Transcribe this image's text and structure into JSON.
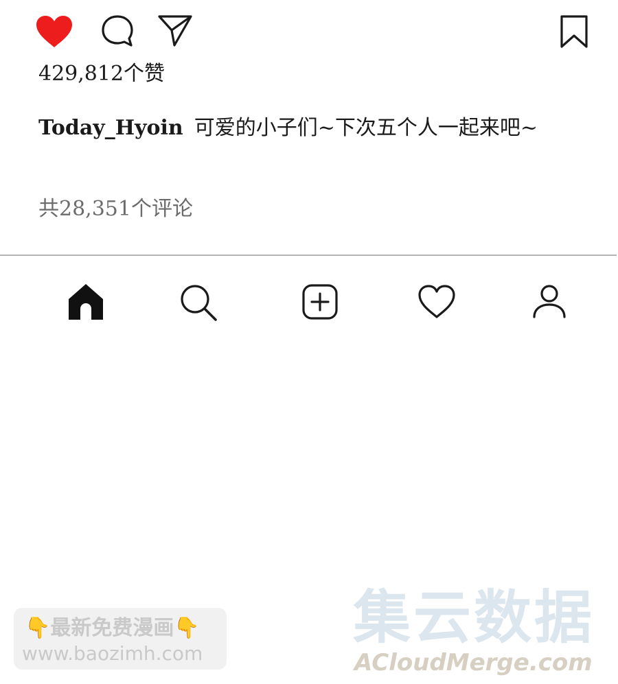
{
  "post": {
    "likes_text": "429,812个赞",
    "caption": {
      "username": "Today_Hyoin",
      "text": "可爱的小子们~下次五个人一起来吧~"
    },
    "comments_text": "共28,351个评论"
  },
  "actions": {
    "like_icon": "heart-filled-icon",
    "comment_icon": "comment-icon",
    "share_icon": "paper-plane-icon",
    "bookmark_icon": "bookmark-icon",
    "like_color": "#ee1d1d"
  },
  "bottom_nav": {
    "items": [
      {
        "icon": "home-icon",
        "active": true
      },
      {
        "icon": "search-icon",
        "active": false
      },
      {
        "icon": "add-post-icon",
        "active": false
      },
      {
        "icon": "heart-outline-icon",
        "active": false
      },
      {
        "icon": "profile-icon",
        "active": false
      }
    ]
  },
  "watermarks": {
    "left_line1": "最新免费漫画",
    "left_line1_hand": "👇",
    "left_line2": "www.baozimh.com",
    "right_cn": "集云数据",
    "right_en": "ACloudMerge.com"
  }
}
